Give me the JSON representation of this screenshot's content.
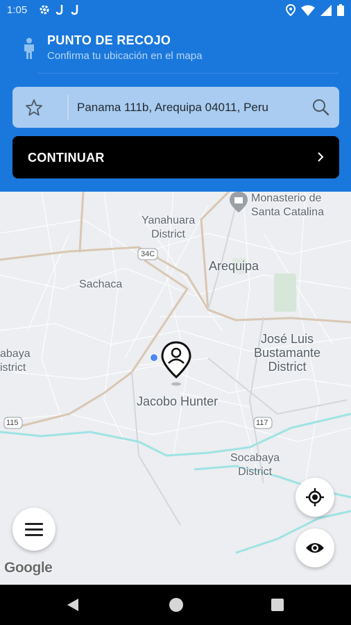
{
  "status_bar": {
    "time": "1:05"
  },
  "header": {
    "title": "PUNTO DE RECOJO",
    "subtitle": "Confirma tu ubicación en el mapa"
  },
  "search": {
    "address": "Panama 111b, Arequipa 04011, Peru"
  },
  "continue_button": {
    "label": "CONTINUAR"
  },
  "map": {
    "labels": {
      "monasterio": "Monasterio de\nSanta Catalina",
      "yanahuara": "Yanahuara\nDistrict",
      "arequipa": "Arequipa",
      "sachaca": "Sachaca",
      "jose_luis": "José Luis\nBustamante\nDistrict",
      "jacobo": "Jacobo Hunter",
      "socabaya": "Socabaya\nDistrict",
      "tiabaya": "abaya\nistrict"
    },
    "road_shields": {
      "r34c": "34C",
      "r115": "115",
      "r117": "117"
    },
    "attribution": "Google"
  },
  "colors": {
    "primary": "#1a78dc",
    "search_bg": "#a9ccf0",
    "button_bg": "#000000"
  }
}
